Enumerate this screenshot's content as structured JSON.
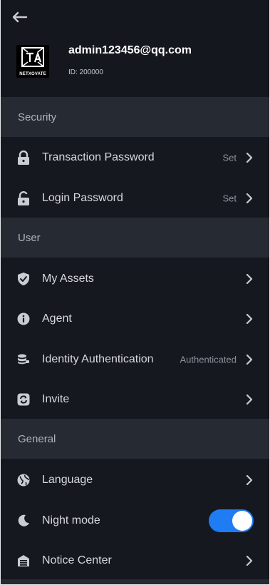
{
  "header": {
    "email": "admin123456@qq.com",
    "id_text": "ID: 200000",
    "logo_text": "NETXOVATE"
  },
  "sections": {
    "security": {
      "title": "Security",
      "transaction_password": {
        "label": "Transaction Password",
        "status": "Set"
      },
      "login_password": {
        "label": "Login Password",
        "status": "Set"
      }
    },
    "user": {
      "title": "User",
      "my_assets": {
        "label": "My Assets"
      },
      "agent": {
        "label": "Agent"
      },
      "identity_authentication": {
        "label": "Identity Authentication",
        "status": "Authenticated"
      },
      "invite": {
        "label": "Invite"
      }
    },
    "general": {
      "title": "General",
      "language": {
        "label": "Language"
      },
      "night_mode": {
        "label": "Night mode",
        "enabled": true
      },
      "notice_center": {
        "label": "Notice Center"
      }
    }
  },
  "icons": {
    "back": "arrow-left-icon",
    "lock": "lock-icon",
    "unlock": "unlock-icon",
    "shield": "shield-check-icon",
    "info": "info-icon",
    "database": "database-icon",
    "invite": "invite-icon",
    "globe": "globe-icon",
    "moon": "moon-icon",
    "notice": "notice-icon",
    "chevron": "chevron-right-icon"
  },
  "colors": {
    "background": "#15181f",
    "section_header": "#262a32",
    "accent": "#1f7cf3",
    "text": "#d6d8dc",
    "muted": "#8d929a"
  }
}
